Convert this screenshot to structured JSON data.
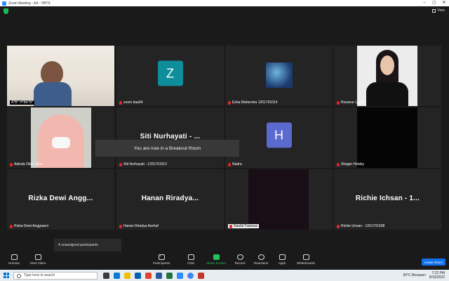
{
  "window": {
    "title": "Zoom Meeting - A4 - VBTS",
    "view_label": "View"
  },
  "participants": [
    {
      "name": "A*B* H*BK*B*",
      "type": "video",
      "active": true
    },
    {
      "name": "zoom baa04",
      "initial": "Z",
      "avatar_color": "#0e8e9a",
      "type": "avatar"
    },
    {
      "name": "Ezha Mahendra 1201701014",
      "type": "image"
    },
    {
      "name": "Rezanur Utami",
      "type": "photo"
    },
    {
      "name": "Adinda Okta Tiara",
      "type": "video"
    },
    {
      "name": "Siti Nurhayati - 1201701012",
      "display": "Siti Nurhayati - ...",
      "type": "name"
    },
    {
      "name": "Nadra",
      "initial": "H",
      "avatar_color": "#5a6acf",
      "type": "avatar"
    },
    {
      "name": "Shager Helaby",
      "type": "black"
    },
    {
      "name": "Rizka Dewi Anggraeni",
      "display": "Rizka Dewi Angg...",
      "type": "name"
    },
    {
      "name": "Hanan Riradya Asshaf",
      "display": "Hanan Riradya...",
      "type": "name"
    },
    {
      "name": "Naufal Fawwaz",
      "type": "dark"
    },
    {
      "name": "Richie Ichsan - 1201701008",
      "display": "Richie Ichsan - 1...",
      "type": "name"
    }
  ],
  "toast": "You are now in a Breakout Room",
  "unassigned": "4 unassigned participants",
  "toolbar": {
    "unmute": "Unmute",
    "start_video": "Start Video",
    "participants": "Participants",
    "participants_count": "12",
    "chat": "Chat",
    "share_screen": "Share Screen",
    "record": "Record",
    "reactions": "Reactions",
    "apps": "Apps",
    "whiteboards": "Whiteboards",
    "leave_room": "Leave Room"
  },
  "taskbar": {
    "search_placeholder": "Type here to search",
    "weather": "30°C  Berawan",
    "time": "7:22 PM",
    "date": "9/15/2022"
  },
  "colors": {
    "active_border": "#c5e84c",
    "accent": "#0e72ed",
    "share_green": "#24c25a"
  }
}
